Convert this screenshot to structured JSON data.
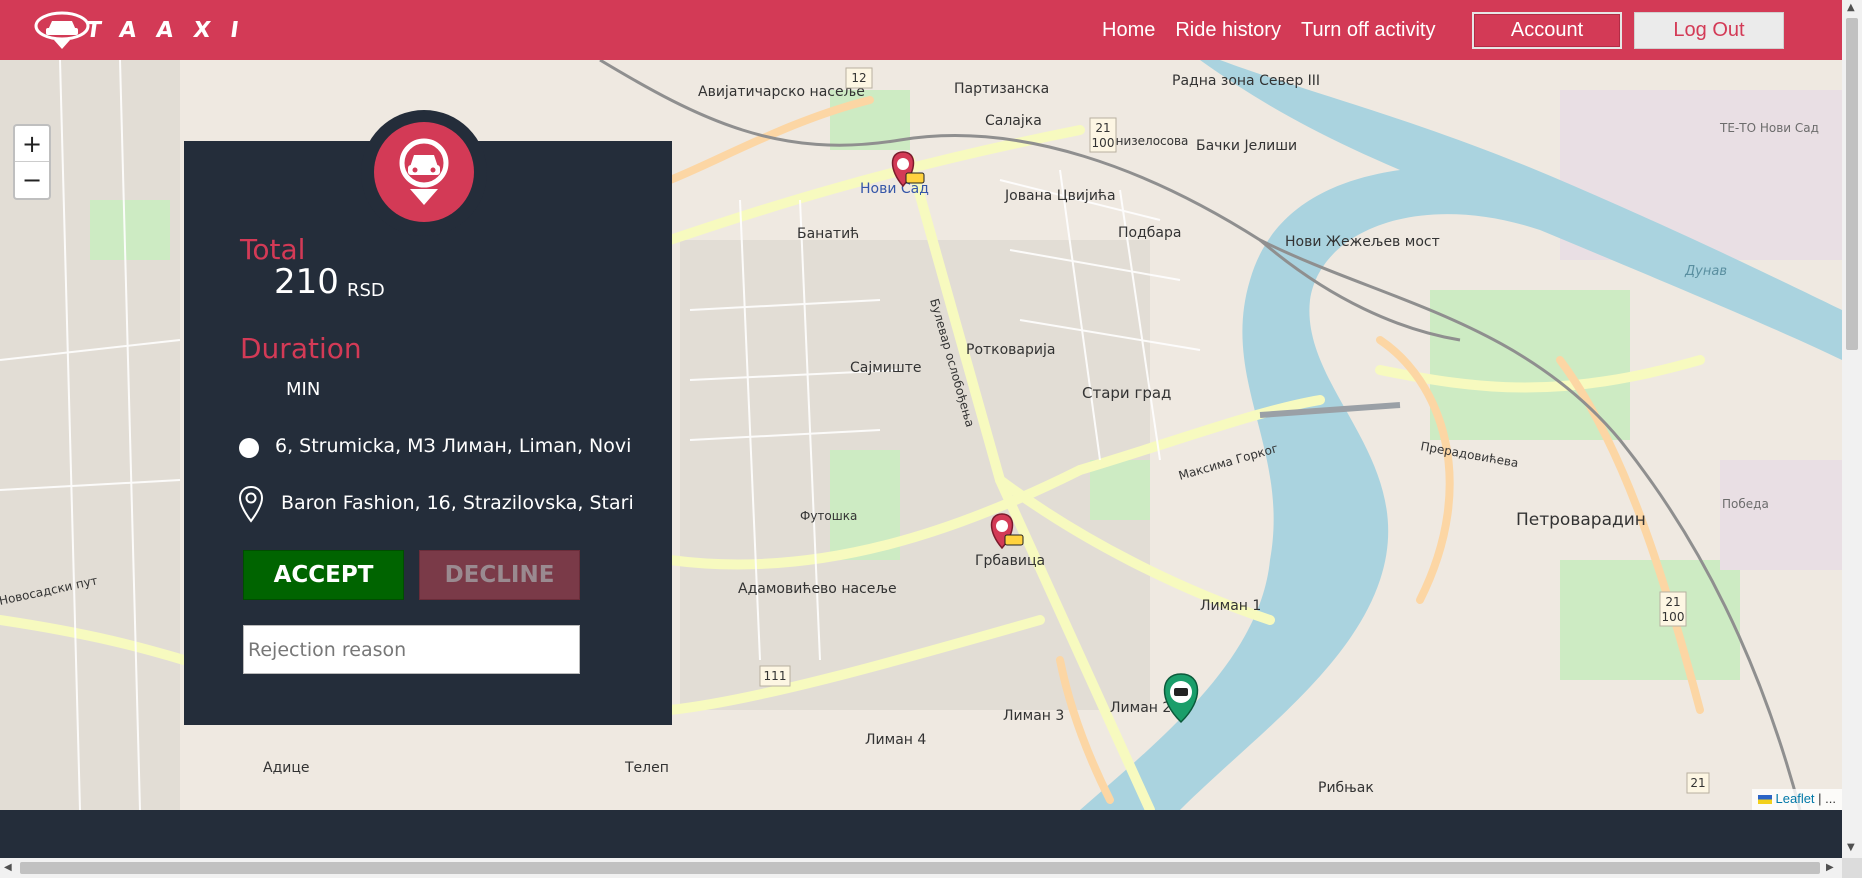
{
  "brand": {
    "logo_text": "TAAXI"
  },
  "nav": {
    "links": [
      "Home",
      "Ride history",
      "Turn off activity"
    ],
    "account_label": "Account",
    "logout_label": "Log Out"
  },
  "colors": {
    "brand": "#d33a56",
    "panel": "#242d3a",
    "accept": "#006400",
    "decline": "#7a3a48"
  },
  "map": {
    "zoom_in": "+",
    "zoom_out": "−",
    "attribution_brand": "Leaflet",
    "attribution_rest": " | ...",
    "labels": [
      "Партизанска",
      "Салајка",
      "Радна зона Север III",
      "Бачки Јелиши",
      "Авијатичарско насеље",
      "Нови Сад",
      "Јована Цвијића",
      "Подбара",
      "Нови Жежељев мост",
      "Банатић",
      "Сајмиште",
      "Ротковарија",
      "Стари град",
      "Петроварадин",
      "Грбавица",
      "Адамовићево насеље",
      "Лиман 1",
      "Лиман 2",
      "Лиман 3",
      "Лиман 4",
      "Адице",
      "Телеп",
      "Рибњак",
      "Победа",
      "Дунав",
      "Футошка",
      "Венизелосова",
      "ТЕ-ТО Нови Сад",
      "Булевар ослобођења",
      "Новосадски пут",
      "Максима Горког",
      "Прерадовићева"
    ],
    "shields": [
      "12",
      "21\n100",
      "111",
      "21"
    ],
    "markers": [
      "pickup-marker",
      "pickup-marker",
      "driver-marker"
    ]
  },
  "ride": {
    "total_label": "Total",
    "total_value": "210",
    "total_unit": "RSD",
    "duration_label": "Duration",
    "duration_value": "",
    "duration_unit": "MIN",
    "from_address": "6, Strumicka, МЗ Лиман, Liman, Novi",
    "to_address": "Baron Fashion, 16, Strazilovska, Stari",
    "accept_label": "ACCEPT",
    "decline_label": "DECLINE",
    "rejection_placeholder": "Rejection reason",
    "rejection_value": ""
  }
}
